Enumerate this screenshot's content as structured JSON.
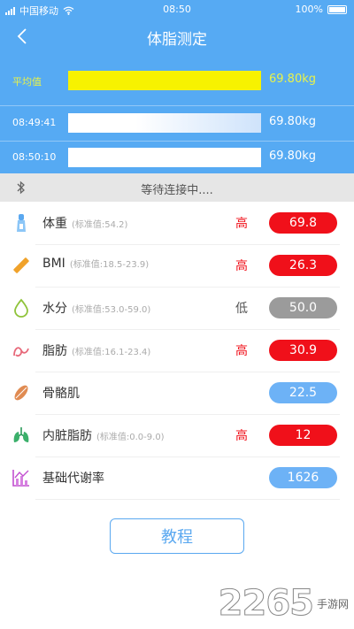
{
  "status_bar": {
    "carrier": "中国移动",
    "time": "08:50",
    "battery": "100%"
  },
  "header": {
    "title": "体脂测定"
  },
  "weight_history": [
    {
      "label": "平均值",
      "value": "69.80kg"
    },
    {
      "label": "08:49:41",
      "value": "69.80kg"
    },
    {
      "label": "08:50:10",
      "value": "69.80kg"
    }
  ],
  "connection": {
    "status": "等待连接中...."
  },
  "metrics": [
    {
      "name": "体重",
      "standard": "(标准值:54.2)",
      "level": "高",
      "value": "69.8",
      "color": "#f0101a",
      "icon": "weight-scale-icon"
    },
    {
      "name": "BMI",
      "standard": "(标准值:18.5-23.9)",
      "level": "高",
      "value": "26.3",
      "color": "#f0101a",
      "icon": "ruler-icon"
    },
    {
      "name": "水分",
      "standard": "(标准值:53.0-59.0)",
      "level": "低",
      "value": "50.0",
      "color": "#9b9b9b",
      "icon": "water-drop-icon"
    },
    {
      "name": "脂肪",
      "standard": "(标准值:16.1-23.4)",
      "level": "高",
      "value": "30.9",
      "color": "#f0101a",
      "icon": "fat-icon"
    },
    {
      "name": "骨骼肌",
      "standard": "",
      "level": "",
      "value": "22.5",
      "color": "#6db2f6",
      "icon": "muscle-icon"
    },
    {
      "name": "内脏脂肪",
      "standard": "(标准值:0.0-9.0)",
      "level": "高",
      "value": "12",
      "color": "#f0101a",
      "icon": "lungs-icon"
    },
    {
      "name": "基础代谢率",
      "standard": "",
      "level": "",
      "value": "1626",
      "color": "#6db2f6",
      "icon": "chart-icon"
    }
  ],
  "tutorial_button": "教程",
  "watermark": {
    "number": "2265",
    "site": "手游网"
  },
  "colors": {
    "header": "#56aaf3",
    "average_bar": "#f7f200",
    "average_label": "#e8f24a",
    "high": "#f0101a",
    "low": "#9b9b9b",
    "normal": "#6db2f6"
  }
}
